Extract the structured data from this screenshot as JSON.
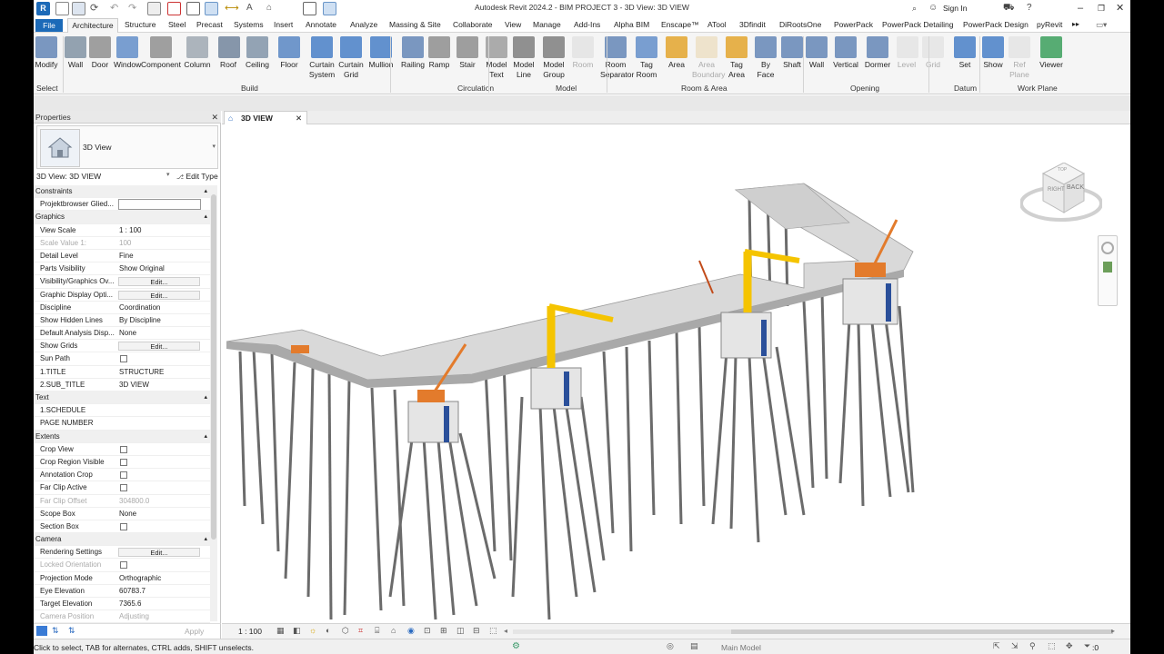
{
  "app": {
    "title": "Autodesk Revit 2024.2 - BIM PROJECT 3 - 3D View: 3D VIEW",
    "logo": "R"
  },
  "account": {
    "sign_in": "Sign In"
  },
  "tabs": [
    "File",
    "Architecture",
    "Structure",
    "Steel",
    "Precast",
    "Systems",
    "Insert",
    "Annotate",
    "Analyze",
    "Massing & Site",
    "Collaborate",
    "View",
    "Manage",
    "Add-Ins",
    "Alpha BIM",
    "Enscape™",
    "ATool",
    "3Dfindit",
    "DiRootsOne",
    "PowerPack",
    "PowerPack Detailing",
    "PowerPack Design",
    "pyRevit"
  ],
  "ribbon": {
    "buttons": [
      {
        "label": "Modify",
        "icon": "cursor-icon"
      },
      {
        "label": "Wall",
        "icon": "wall-icon"
      },
      {
        "label": "Door",
        "icon": "door-icon"
      },
      {
        "label": "Window",
        "icon": "window-icon"
      },
      {
        "label": "Component",
        "icon": "component-icon"
      },
      {
        "label": "Column",
        "icon": "column-icon"
      },
      {
        "label": "Roof",
        "icon": "roof-icon"
      },
      {
        "label": "Ceiling",
        "icon": "ceiling-icon"
      },
      {
        "label": "Floor",
        "icon": "floor-icon"
      },
      {
        "label": "Curtain System",
        "icon": "curtain-system-icon"
      },
      {
        "label": "Curtain Grid",
        "icon": "curtain-grid-icon"
      },
      {
        "label": "Mullion",
        "icon": "mullion-icon"
      },
      {
        "label": "Railing",
        "icon": "railing-icon"
      },
      {
        "label": "Ramp",
        "icon": "ramp-icon"
      },
      {
        "label": "Stair",
        "icon": "stair-icon"
      },
      {
        "label": "Model Text",
        "icon": "model-text-icon"
      },
      {
        "label": "Model Line",
        "icon": "model-line-icon"
      },
      {
        "label": "Model Group",
        "icon": "model-group-icon"
      },
      {
        "label": "Room",
        "icon": "room-icon"
      },
      {
        "label": "Room Separator",
        "icon": "room-separator-icon"
      },
      {
        "label": "Tag Room",
        "icon": "tag-room-icon"
      },
      {
        "label": "Area",
        "icon": "area-icon"
      },
      {
        "label": "Area Boundary",
        "icon": "area-boundary-icon"
      },
      {
        "label": "Tag Area",
        "icon": "tag-area-icon"
      },
      {
        "label": "By Face",
        "icon": "by-face-icon"
      },
      {
        "label": "Shaft",
        "icon": "shaft-icon"
      },
      {
        "label": "Wall",
        "icon": "wall-opening-icon"
      },
      {
        "label": "Vertical",
        "icon": "vertical-icon"
      },
      {
        "label": "Dormer",
        "icon": "dormer-icon"
      },
      {
        "label": "Level",
        "icon": "level-icon"
      },
      {
        "label": "Grid",
        "icon": "grid-icon"
      },
      {
        "label": "Set",
        "icon": "set-icon"
      },
      {
        "label": "Show",
        "icon": "show-icon"
      },
      {
        "label": "Ref Plane",
        "icon": "ref-plane-icon"
      },
      {
        "label": "Viewer",
        "icon": "viewer-icon"
      }
    ],
    "panels": [
      "Select",
      "Build",
      "Circulation",
      "Model",
      "Room & Area",
      "Opening",
      "Datum",
      "Work Plane"
    ]
  },
  "properties": {
    "title": "Properties",
    "type_name": "3D View",
    "instance_selector": "3D View: 3D VIEW",
    "edit_type": "Edit Type",
    "apply": "Apply",
    "rows": [
      {
        "k": "Constraints",
        "cat": true
      },
      {
        "k": "Projektbrowser Glied...",
        "v": "",
        "input": true
      },
      {
        "k": "Graphics",
        "cat": true
      },
      {
        "k": "View Scale",
        "v": "1 : 100"
      },
      {
        "k": "Scale Value   1:",
        "v": "100",
        "dim": true
      },
      {
        "k": "Detail Level",
        "v": "Fine"
      },
      {
        "k": "Parts Visibility",
        "v": "Show Original"
      },
      {
        "k": "Visibility/Graphics Ov...",
        "v": "Edit...",
        "btn": true
      },
      {
        "k": "Graphic Display Opti...",
        "v": "Edit...",
        "btn": true
      },
      {
        "k": "Discipline",
        "v": "Coordination"
      },
      {
        "k": "Show Hidden Lines",
        "v": "By Discipline"
      },
      {
        "k": "Default Analysis Disp...",
        "v": "None"
      },
      {
        "k": "Show Grids",
        "v": "Edit...",
        "btn": true
      },
      {
        "k": "Sun Path",
        "v": "",
        "check": true
      },
      {
        "k": "1.TITLE",
        "v": "STRUCTURE"
      },
      {
        "k": "2.SUB_TITLE",
        "v": "3D VIEW"
      },
      {
        "k": "Text",
        "cat": true
      },
      {
        "k": "1.SCHEDULE",
        "v": ""
      },
      {
        "k": "PAGE NUMBER",
        "v": ""
      },
      {
        "k": "Extents",
        "cat": true
      },
      {
        "k": "Crop View",
        "v": "",
        "check": true
      },
      {
        "k": "Crop Region Visible",
        "v": "",
        "check": true
      },
      {
        "k": "Annotation Crop",
        "v": "",
        "check": true
      },
      {
        "k": "Far Clip Active",
        "v": "",
        "check": true
      },
      {
        "k": "Far Clip Offset",
        "v": "304800.0",
        "dim": true
      },
      {
        "k": "Scope Box",
        "v": "None"
      },
      {
        "k": "Section Box",
        "v": "",
        "check": true
      },
      {
        "k": "Camera",
        "cat": true
      },
      {
        "k": "Rendering Settings",
        "v": "Edit...",
        "btn": true
      },
      {
        "k": "Locked Orientation",
        "v": "",
        "check": true,
        "dim": true
      },
      {
        "k": "Projection Mode",
        "v": "Orthographic"
      },
      {
        "k": "Eye Elevation",
        "v": "60783.7"
      },
      {
        "k": "Target Elevation",
        "v": "7365.6"
      },
      {
        "k": "Camera Position",
        "v": "Adjusting",
        "dim": true
      }
    ]
  },
  "view": {
    "tab_label": "3D VIEW",
    "scale": "1 : 100"
  },
  "viewcube": {
    "right": "RIGHT",
    "back": "BACK",
    "top": "TOP"
  },
  "status": {
    "hint": "Click to select, TAB for alternates, CTRL adds, SHIFT unselects.",
    "workset": "Main Model",
    "zero": ":0"
  },
  "colors": {
    "accent": "#1c6ab8",
    "crane_yellow": "#f5c400",
    "crane_orange": "#e37b2c",
    "pile_gray": "#6b6b6b",
    "pier_blue": "#2a4f9a"
  }
}
